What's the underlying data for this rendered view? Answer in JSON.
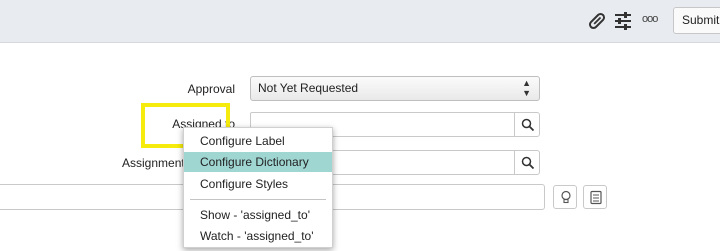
{
  "toolbar": {
    "icons": [
      "paperclip-icon",
      "sliders-icon",
      "more-options-icon"
    ],
    "more_glyph": "ooo",
    "submit_label": "Submit"
  },
  "form": {
    "approval": {
      "label": "Approval",
      "value": "Not Yet Requested"
    },
    "assigned_to": {
      "label": "Assigned to",
      "value": ""
    },
    "assignment_group": {
      "label": "Assignment group",
      "value": ""
    },
    "configuration_item": {
      "value": ""
    }
  },
  "context_menu": {
    "items": [
      {
        "label": "Configure Label",
        "active": false
      },
      {
        "label": "Configure Dictionary",
        "active": true
      },
      {
        "label": "Configure Styles",
        "active": false
      },
      {
        "label": "Show - 'assigned_to'",
        "active": false
      },
      {
        "label": "Watch - 'assigned_to'",
        "active": false
      }
    ]
  },
  "colors": {
    "toolbar_bg": "#e8ebef",
    "menu_highlight": "#9fd6d2",
    "annotation_box": "#f5eb0c"
  }
}
